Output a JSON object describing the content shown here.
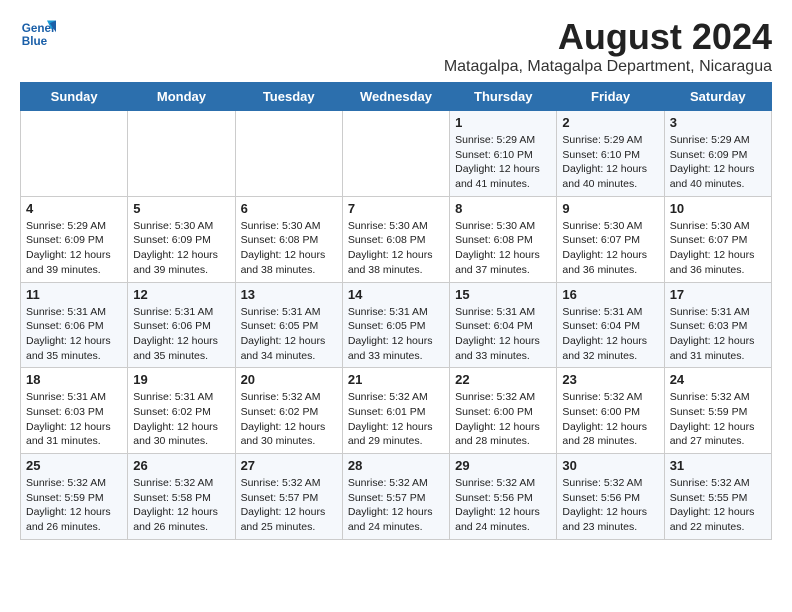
{
  "logo": {
    "line1": "General",
    "line2": "Blue"
  },
  "title": "August 2024",
  "subtitle": "Matagalpa, Matagalpa Department, Nicaragua",
  "header": {
    "accent_color": "#2c6fad"
  },
  "days_of_week": [
    "Sunday",
    "Monday",
    "Tuesday",
    "Wednesday",
    "Thursday",
    "Friday",
    "Saturday"
  ],
  "weeks": [
    [
      {
        "day": "",
        "info": ""
      },
      {
        "day": "",
        "info": ""
      },
      {
        "day": "",
        "info": ""
      },
      {
        "day": "",
        "info": ""
      },
      {
        "day": "1",
        "info": "Sunrise: 5:29 AM\nSunset: 6:10 PM\nDaylight: 12 hours\nand 41 minutes."
      },
      {
        "day": "2",
        "info": "Sunrise: 5:29 AM\nSunset: 6:10 PM\nDaylight: 12 hours\nand 40 minutes."
      },
      {
        "day": "3",
        "info": "Sunrise: 5:29 AM\nSunset: 6:09 PM\nDaylight: 12 hours\nand 40 minutes."
      }
    ],
    [
      {
        "day": "4",
        "info": "Sunrise: 5:29 AM\nSunset: 6:09 PM\nDaylight: 12 hours\nand 39 minutes."
      },
      {
        "day": "5",
        "info": "Sunrise: 5:30 AM\nSunset: 6:09 PM\nDaylight: 12 hours\nand 39 minutes."
      },
      {
        "day": "6",
        "info": "Sunrise: 5:30 AM\nSunset: 6:08 PM\nDaylight: 12 hours\nand 38 minutes."
      },
      {
        "day": "7",
        "info": "Sunrise: 5:30 AM\nSunset: 6:08 PM\nDaylight: 12 hours\nand 38 minutes."
      },
      {
        "day": "8",
        "info": "Sunrise: 5:30 AM\nSunset: 6:08 PM\nDaylight: 12 hours\nand 37 minutes."
      },
      {
        "day": "9",
        "info": "Sunrise: 5:30 AM\nSunset: 6:07 PM\nDaylight: 12 hours\nand 36 minutes."
      },
      {
        "day": "10",
        "info": "Sunrise: 5:30 AM\nSunset: 6:07 PM\nDaylight: 12 hours\nand 36 minutes."
      }
    ],
    [
      {
        "day": "11",
        "info": "Sunrise: 5:31 AM\nSunset: 6:06 PM\nDaylight: 12 hours\nand 35 minutes."
      },
      {
        "day": "12",
        "info": "Sunrise: 5:31 AM\nSunset: 6:06 PM\nDaylight: 12 hours\nand 35 minutes."
      },
      {
        "day": "13",
        "info": "Sunrise: 5:31 AM\nSunset: 6:05 PM\nDaylight: 12 hours\nand 34 minutes."
      },
      {
        "day": "14",
        "info": "Sunrise: 5:31 AM\nSunset: 6:05 PM\nDaylight: 12 hours\nand 33 minutes."
      },
      {
        "day": "15",
        "info": "Sunrise: 5:31 AM\nSunset: 6:04 PM\nDaylight: 12 hours\nand 33 minutes."
      },
      {
        "day": "16",
        "info": "Sunrise: 5:31 AM\nSunset: 6:04 PM\nDaylight: 12 hours\nand 32 minutes."
      },
      {
        "day": "17",
        "info": "Sunrise: 5:31 AM\nSunset: 6:03 PM\nDaylight: 12 hours\nand 31 minutes."
      }
    ],
    [
      {
        "day": "18",
        "info": "Sunrise: 5:31 AM\nSunset: 6:03 PM\nDaylight: 12 hours\nand 31 minutes."
      },
      {
        "day": "19",
        "info": "Sunrise: 5:31 AM\nSunset: 6:02 PM\nDaylight: 12 hours\nand 30 minutes."
      },
      {
        "day": "20",
        "info": "Sunrise: 5:32 AM\nSunset: 6:02 PM\nDaylight: 12 hours\nand 30 minutes."
      },
      {
        "day": "21",
        "info": "Sunrise: 5:32 AM\nSunset: 6:01 PM\nDaylight: 12 hours\nand 29 minutes."
      },
      {
        "day": "22",
        "info": "Sunrise: 5:32 AM\nSunset: 6:00 PM\nDaylight: 12 hours\nand 28 minutes."
      },
      {
        "day": "23",
        "info": "Sunrise: 5:32 AM\nSunset: 6:00 PM\nDaylight: 12 hours\nand 28 minutes."
      },
      {
        "day": "24",
        "info": "Sunrise: 5:32 AM\nSunset: 5:59 PM\nDaylight: 12 hours\nand 27 minutes."
      }
    ],
    [
      {
        "day": "25",
        "info": "Sunrise: 5:32 AM\nSunset: 5:59 PM\nDaylight: 12 hours\nand 26 minutes."
      },
      {
        "day": "26",
        "info": "Sunrise: 5:32 AM\nSunset: 5:58 PM\nDaylight: 12 hours\nand 26 minutes."
      },
      {
        "day": "27",
        "info": "Sunrise: 5:32 AM\nSunset: 5:57 PM\nDaylight: 12 hours\nand 25 minutes."
      },
      {
        "day": "28",
        "info": "Sunrise: 5:32 AM\nSunset: 5:57 PM\nDaylight: 12 hours\nand 24 minutes."
      },
      {
        "day": "29",
        "info": "Sunrise: 5:32 AM\nSunset: 5:56 PM\nDaylight: 12 hours\nand 24 minutes."
      },
      {
        "day": "30",
        "info": "Sunrise: 5:32 AM\nSunset: 5:56 PM\nDaylight: 12 hours\nand 23 minutes."
      },
      {
        "day": "31",
        "info": "Sunrise: 5:32 AM\nSunset: 5:55 PM\nDaylight: 12 hours\nand 22 minutes."
      }
    ]
  ]
}
